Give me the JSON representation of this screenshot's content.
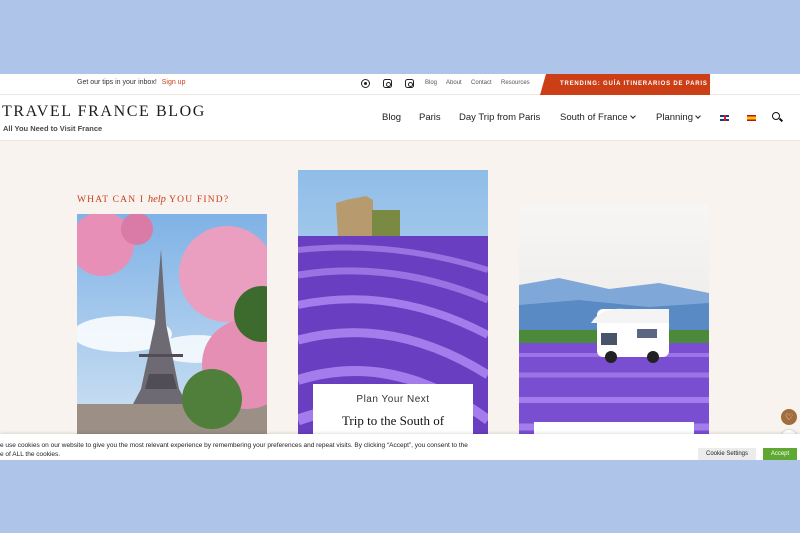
{
  "topbar": {
    "promo_text": "Get our tips in your inbox!",
    "signup_label": "Sign up",
    "links": [
      "Blog",
      "About",
      "Contact",
      "Resources"
    ],
    "trending_label": "TRENDING: GUÍA ITINERARIOS DE PARIS"
  },
  "header": {
    "logo": "TRAVEL FRANCE BLOG",
    "tagline": "All You Need to Visit France",
    "nav": [
      "Blog",
      "Paris",
      "Day Trip from Paris",
      "South of France",
      "Planning"
    ]
  },
  "hero": {
    "eyebrow_before": "WHAT CAN I ",
    "eyebrow_script": "help",
    "eyebrow_after": " YOU FIND?",
    "card2_line1": "Plan Your Next",
    "card2_line2": "Trip to the South of"
  },
  "cookie": {
    "line1": "e use cookies on our website to give you the most relevant experience by remembering your preferences and repeat visits. By clicking “Accept”, you consent to the",
    "line2": "e of ALL the cookies.",
    "settings_label": "Cookie Settings",
    "accept_label": "Accept"
  },
  "icons": {
    "heart": "♡",
    "share": "⋖"
  },
  "colors": {
    "accent": "#c8401b",
    "trend_bg": "#cc3e15",
    "page_bg": "#f8f3ee",
    "frame_bg": "#aec4e8",
    "accept_bg": "#5fa831"
  }
}
